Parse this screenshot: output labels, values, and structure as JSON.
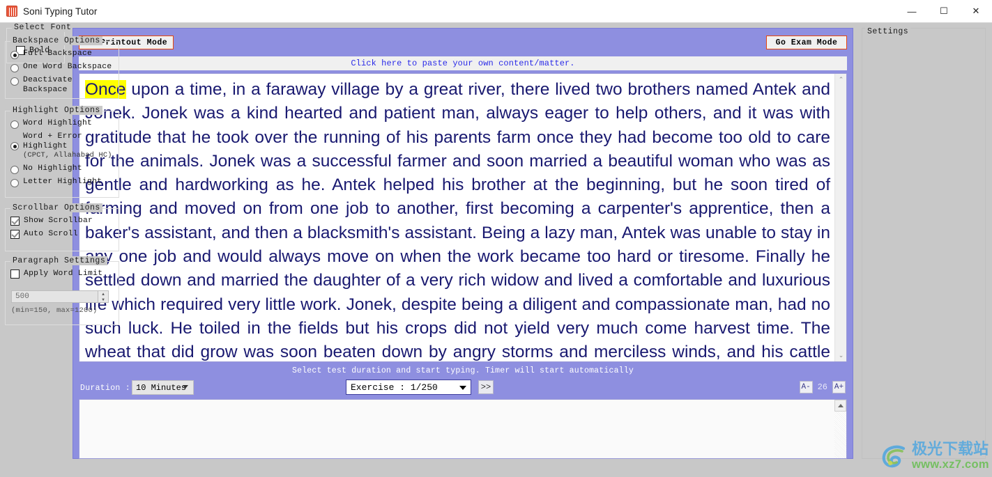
{
  "window": {
    "title": "Soni Typing Tutor",
    "icon": "app-book-icon",
    "minimize": "—",
    "maximize": "☐",
    "close": "✕"
  },
  "left_panel": {
    "legend": "Select Font",
    "bold_label": "Bold",
    "bold_checked": false
  },
  "main": {
    "printout_button": "Go Printout Mode",
    "exam_button": "Go Exam Mode",
    "paste_link": "Click here to paste your own content/matter.",
    "passage": {
      "highlight_word": "Once",
      "rest": " upon a time, in a faraway village by a great river, there lived two brothers named Antek and Jonek. Jonek was a kind hearted and patient man, always eager to help others, and it was with gratitude that he took over the running of his parents farm once they had become too old to care for the animals. Jonek was a successful farmer and soon married a beautiful woman who was as gentle and hardworking as he. Antek helped his brother at the beginning, but he soon tired of farming and moved on from one job to another, first becoming a carpenter's apprentice, then a baker's assistant, and then a blacksmith's assistant. Being a lazy man, Antek was unable to stay in any one job and would always move on when the work became too hard or tiresome. Finally he settled down and married the daughter of a very rich widow and lived a comfortable and luxurious life which required very little work. Jonek, despite being a diligent and compassionate man, had no such luck. He toiled in the fields but his crops did not yield very much come harvest time. The wheat that did grow was soon beaten down by angry storms and merciless winds, and his cattle were plagued by"
    },
    "scroll_up_icon": "⌃",
    "scroll_down_icon": "⌄",
    "status_text": "Select test duration and start typing. Timer will start automatically",
    "duration_label": "Duration :",
    "duration_value": "10 Minutes",
    "exercise_value": "Exercise : 1/250",
    "next_exercise_button": ">>",
    "font_decrease": "A-",
    "font_size_value": "26",
    "font_increase": "A+",
    "typing_input_value": ""
  },
  "settings": {
    "legend": "Settings",
    "backspace": {
      "legend": "Backspace Options",
      "options": [
        {
          "label": "Full Backspace",
          "selected": true
        },
        {
          "label": "One Word Backspace",
          "selected": false
        },
        {
          "label": "Deactivate Backspace",
          "selected": false
        }
      ]
    },
    "highlight": {
      "legend": "Highlight Options",
      "options": [
        {
          "label": "Word Highlight",
          "sub": "",
          "selected": false
        },
        {
          "label": "Word + Error Highlight",
          "sub": "(CPCT, Allahabad HC)",
          "selected": true
        },
        {
          "label": "No Highlight",
          "sub": "",
          "selected": false
        },
        {
          "label": "Letter Highlight",
          "sub": "",
          "selected": false
        }
      ]
    },
    "scrollbar": {
      "legend": "Scrollbar Options",
      "options": [
        {
          "label": "Show Scrollbar",
          "checked": true
        },
        {
          "label": "Auto Scroll",
          "checked": true
        }
      ]
    },
    "paragraph": {
      "legend": "Paragraph Settings",
      "word_limit_label": "Apply Word Limit",
      "word_limit_checked": false,
      "word_limit_value": "500",
      "minmax_note": "(min=150, max=1200)"
    }
  },
  "watermark": {
    "cn": "极光下载站",
    "url": "www.xz7.com"
  },
  "colors": {
    "panel_purple": "#8e8fe0",
    "button_border_orange": "#e8470c",
    "link_blue": "#2a2ae8",
    "highlight_yellow": "#ffff00",
    "text_navy": "#191970"
  }
}
